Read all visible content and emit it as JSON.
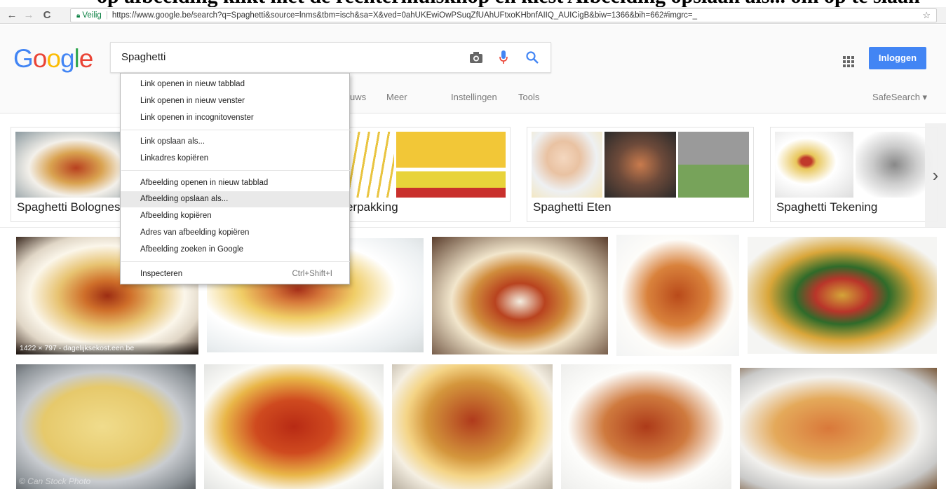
{
  "browser": {
    "back": "←",
    "forward": "→",
    "reload": "C",
    "secure_label": "Veilig",
    "url": "https://www.google.be/search?q=Spaghetti&source=lnms&tbm=isch&sa=X&ved=0ahUKEwiOwPSuqZfUAhUFtxoKHbnfAIIQ_AUICigB&biw=1366&bih=662#imgrc=_",
    "star": "☆"
  },
  "top_crop_text": "op afbeelding klikt met de rechtermuisknop en kiest Afbeelding opslaan als... om op te slaan",
  "google": {
    "logo_letters": [
      "G",
      "o",
      "o",
      "g",
      "l",
      "e"
    ],
    "logo_colors": [
      "#4285f4",
      "#ea4335",
      "#fbbc05",
      "#4285f4",
      "#34a853",
      "#ea4335"
    ],
    "query": "Spaghetti",
    "signin_label": "Inloggen",
    "safesearch": "SafeSearch ▾"
  },
  "tabs": [
    {
      "label": "uws"
    },
    {
      "label": "Meer"
    },
    {
      "label": "Instellingen"
    },
    {
      "label": "Tools"
    }
  ],
  "related": [
    {
      "label": "Spaghetti Bolognese"
    },
    {
      "label": "Spaghetti Verpakking"
    },
    {
      "label": "Spaghetti Eten"
    },
    {
      "label": "Spaghetti Tekening"
    }
  ],
  "first_image_caption": "1422 × 797 - dagelijksekost.een.be",
  "watermark": "© Can Stock Photo",
  "context_menu": [
    {
      "label": "Link openen in nieuw tabblad",
      "shortcut": ""
    },
    {
      "label": "Link openen in nieuw venster",
      "shortcut": ""
    },
    {
      "label": "Link openen in incognitovenster",
      "shortcut": ""
    },
    {
      "label": "Link opslaan als...",
      "shortcut": ""
    },
    {
      "label": "Linkadres kopiëren",
      "shortcut": ""
    },
    {
      "label": "Afbeelding openen in nieuw tabblad",
      "shortcut": ""
    },
    {
      "label": "Afbeelding opslaan als...",
      "shortcut": ""
    },
    {
      "label": "Afbeelding kopiëren",
      "shortcut": ""
    },
    {
      "label": "Adres van afbeelding kopiëren",
      "shortcut": ""
    },
    {
      "label": "Afbeelding zoeken in Google",
      "shortcut": ""
    },
    {
      "label": "Inspecteren",
      "shortcut": "Ctrl+Shift+I"
    }
  ],
  "colors": {
    "accent": "#4285f4",
    "secure": "#0b8043",
    "menu_hover": "#e9e9e9"
  }
}
